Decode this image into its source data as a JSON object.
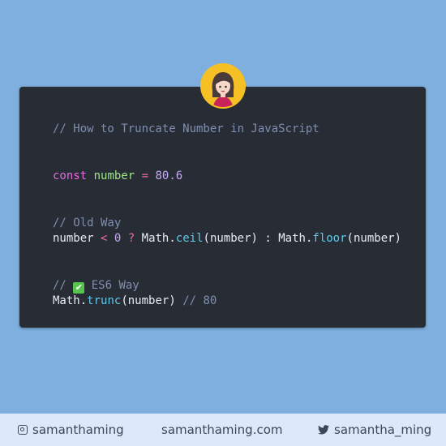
{
  "code": {
    "title_comment": "// How to Truncate Number in JavaScript",
    "decl": {
      "keyword": "const",
      "name": "number",
      "eq": "=",
      "value": "80.6"
    },
    "old_comment": "// Old Way",
    "old_line": {
      "v1": "number",
      "lt": "<",
      "zero": "0",
      "q": "?",
      "m1": "Math.",
      "ceil": "ceil",
      "args1": "(number) : ",
      "m2": "Math.",
      "floor": "floor",
      "args2": "(number)"
    },
    "es6_comment_prefix": "//",
    "es6_check": "✔",
    "es6_comment_text": "ES6 Way",
    "es6_line": {
      "m": "Math.",
      "trunc": "trunc",
      "args": "(number)",
      "result_comment": "// 80"
    }
  },
  "footer": {
    "instagram": "samanthaming",
    "website": "samanthaming.com",
    "twitter": "samantha_ming"
  },
  "icons": {
    "instagram": "instagram-icon",
    "twitter": "twitter-icon",
    "avatar": "avatar"
  },
  "colors": {
    "background": "#7eafde",
    "card": "#282c35",
    "footer": "#dde9fb",
    "comment": "#7f8fb0",
    "keyword": "#e36ce0",
    "identifier": "#9ee58a",
    "number": "#c7a8f5",
    "function": "#5ec8ea",
    "check": "#57c44d"
  }
}
